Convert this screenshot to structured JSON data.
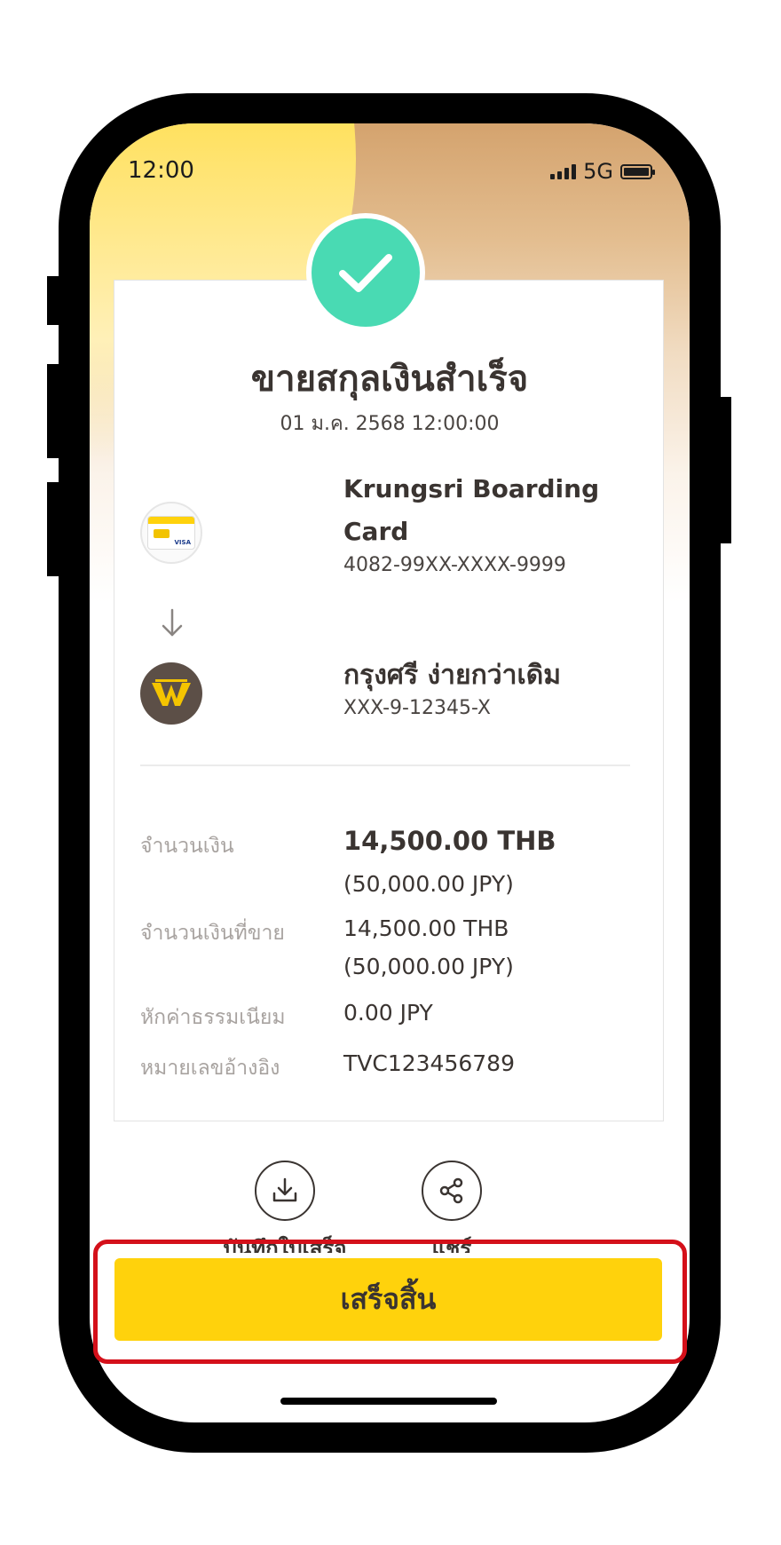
{
  "status_bar": {
    "time": "12:00",
    "network": "5G",
    "battery_level": 1.0
  },
  "receipt": {
    "title": "ขายสกุลเงินสำเร็จ",
    "datetime": "01 ม.ค. 2568 12:00:00",
    "from": {
      "name": "Krungsri Boarding Card",
      "number": "4082-99XX-XXXX-9999",
      "card_brand": "VISA"
    },
    "to": {
      "name": "กรุงศรี ง่ายกว่าเดิม",
      "number": "XXX-9-12345-X"
    },
    "rows": [
      {
        "label": "จำนวนเงิน",
        "value": "14,500.00 THB",
        "sub": "(50,000.00 JPY)"
      },
      {
        "label": "จำนวนเงินที่ขาย",
        "value": "14,500.00 THB",
        "sub": "(50,000.00 JPY)"
      },
      {
        "label": "หักค่าธรรมเนียม",
        "value": "0.00 JPY"
      },
      {
        "label": "หมายเลขอ้างอิง",
        "value": "TVC123456789"
      }
    ]
  },
  "actions": {
    "save_label": "บันทึกใบเสร็จ",
    "share_label": "แชร์"
  },
  "done_button": {
    "label": "เสร็จสิ้น"
  },
  "colors": {
    "accent_yellow": "#ffd20c",
    "success_green": "#49dab3",
    "highlight_red": "#d4101a",
    "text_dark": "#3a3431",
    "text_muted": "#a8a3a0"
  },
  "icons": {
    "success": "checkmark-icon",
    "arrow": "arrow-down-icon",
    "download": "download-icon",
    "share": "share-icon"
  }
}
